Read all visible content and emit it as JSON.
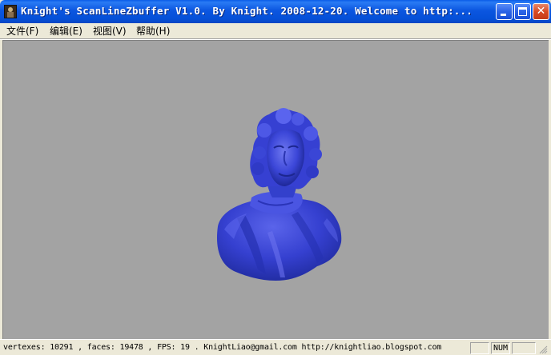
{
  "window": {
    "title": "Knight's ScanLineZbuffer V1.0. By Knight. 2008-12-20.  Welcome to http:...",
    "icon": "app-portrait-icon",
    "controls": {
      "minimize_icon": "minimize-icon",
      "maximize_icon": "maximize-icon",
      "close_label": "✕"
    }
  },
  "menu": {
    "items": [
      {
        "label": "文件(F)"
      },
      {
        "label": "编辑(E)"
      },
      {
        "label": "视图(V)"
      },
      {
        "label": "帮助(H)"
      }
    ]
  },
  "viewport": {
    "background": "#a3a3a3",
    "model_color": "#3a45d6",
    "model": "bust"
  },
  "status": {
    "text": "vertexes: 10291 , faces: 19478 , FPS: 19 .   KnightLiao@gmail.com   http://knightliao.blogspot.com",
    "panes": [
      "",
      "NUM",
      ""
    ]
  }
}
